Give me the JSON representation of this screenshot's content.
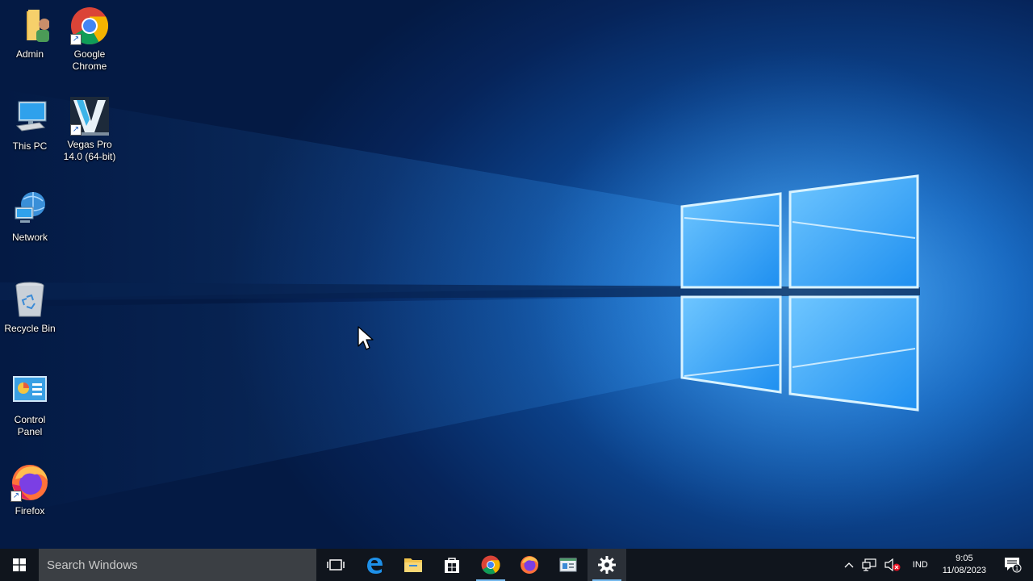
{
  "desktop": {
    "icons": [
      {
        "label_lines": [
          "Admin"
        ],
        "icon": "user-folder-icon"
      },
      {
        "label_lines": [
          "Google",
          "Chrome"
        ],
        "icon": "chrome-icon"
      },
      {
        "label_lines": [
          "This PC"
        ],
        "icon": "computer-icon"
      },
      {
        "label_lines": [
          "Vegas Pro",
          "14.0 (64-bit)"
        ],
        "icon": "vegas-pro-icon"
      },
      {
        "label_lines": [
          "Network"
        ],
        "icon": "network-icon"
      },
      {
        "label_lines": [
          "Recycle Bin"
        ],
        "icon": "recycle-bin-icon"
      },
      {
        "label_lines": [
          "Control",
          "Panel"
        ],
        "icon": "control-panel-icon"
      },
      {
        "label_lines": [
          "Firefox"
        ],
        "icon": "firefox-icon"
      }
    ]
  },
  "taskbar": {
    "search_placeholder": "Search Windows",
    "pinned": [
      "task-view",
      "edge",
      "file-explorer",
      "store",
      "chrome",
      "firefox",
      "app",
      "settings"
    ],
    "tray": {
      "language": "IND",
      "time": "9:05",
      "date": "11/08/2023",
      "notification_count": "1"
    }
  },
  "colors": {
    "taskbar": "#10151d",
    "search_box": "#3b3f44",
    "accent": "#76b9ed"
  }
}
